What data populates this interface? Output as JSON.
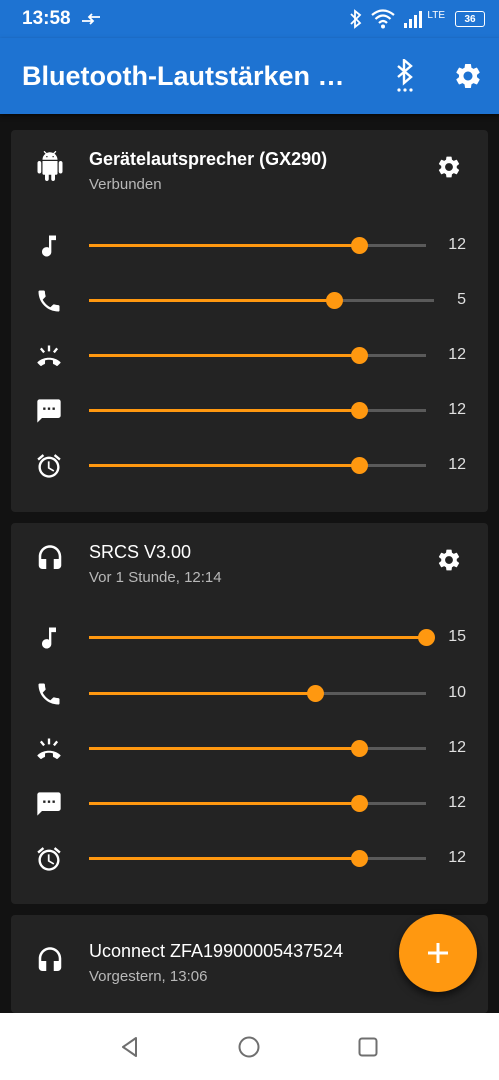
{
  "status_bar": {
    "time": "13:58",
    "network": "LTE",
    "battery": "36"
  },
  "app_bar": {
    "title": "Bluetooth-Lautstärken Manager"
  },
  "cards": [
    {
      "device": "Gerätelautsprecher (GX290)",
      "status": "Verbunden",
      "device_icon": "android-icon",
      "rows": [
        {
          "icon": "music-note-icon",
          "value": "12",
          "level": 0.8
        },
        {
          "icon": "phone-icon",
          "value": "5",
          "level": 0.71
        },
        {
          "icon": "ringer-icon",
          "value": "12",
          "level": 0.8
        },
        {
          "icon": "message-icon",
          "value": "12",
          "level": 0.8
        },
        {
          "icon": "alarm-icon",
          "value": "12",
          "level": 0.8
        }
      ]
    },
    {
      "device": "SRCS V3.00",
      "status": "Vor 1 Stunde, 12:14",
      "device_icon": "headphones-icon",
      "rows": [
        {
          "icon": "music-note-icon",
          "value": "15",
          "level": 1.0
        },
        {
          "icon": "phone-icon",
          "value": "10",
          "level": 0.67
        },
        {
          "icon": "ringer-icon",
          "value": "12",
          "level": 0.8
        },
        {
          "icon": "message-icon",
          "value": "12",
          "level": 0.8
        },
        {
          "icon": "alarm-icon",
          "value": "12",
          "level": 0.8
        }
      ]
    },
    {
      "device": "Uconnect ZFA19900005437524",
      "status": "Vorgestern, 13:06",
      "device_icon": "headphones-icon"
    }
  ],
  "colors": {
    "primary": "#1e73d2",
    "accent": "#ff9810",
    "card": "#232323",
    "background": "#121212"
  }
}
